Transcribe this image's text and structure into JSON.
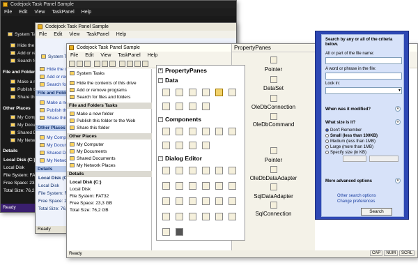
{
  "dark": {
    "title": "Codejock Task Panel Sample",
    "menu": [
      "File",
      "Edit",
      "View",
      "TaskPanel",
      "Help"
    ],
    "system_tasks": "System Tasks",
    "tasks": [
      "Hide the contents of this drive",
      "Add or remove programs",
      "Search for files and folders"
    ],
    "file_folder_title": "File and Folders Tasks",
    "file_folder_tasks": [
      "Make a new folder",
      "Publish this folder to the Web",
      "Share this folder"
    ],
    "other_title": "Other Places",
    "other": [
      "My Computer",
      "My Documents",
      "Shared Documents",
      "My Network Places"
    ],
    "details_title": "Details",
    "details": [
      "Local Disk (C:)",
      "Local Disk",
      "File System: FAT32",
      "Free Space: 23,3 GB",
      "Total Size: 76,2 GB"
    ],
    "status": "Ready"
  },
  "blue": {
    "title": "Codejock Task Panel Sample",
    "menu": [
      "File",
      "Edit",
      "View",
      "TaskPanel",
      "Help"
    ],
    "system_tasks": "System Tasks",
    "tasks": [
      "Hide the contents of this drive",
      "Add or remove programs",
      "Search for files and folders"
    ],
    "file_folder_title": "File and Folders Tasks",
    "file_folder_tasks": [
      "Make a new folder",
      "Publish this folder to the Web",
      "Share this folder"
    ],
    "other_title": "Other Places",
    "other": [
      "My Computer",
      "My Documents",
      "Shared Documents",
      "My Network Places"
    ],
    "details_title": "Details",
    "details": [
      "Local Disk (C:)",
      "Local Disk",
      "File System: FAT32",
      "Free Space: 23,3 GB",
      "Total Size: 76,2 GB"
    ],
    "status": "Ready"
  },
  "main": {
    "title": "Codejock Task Panel Sample",
    "menu": [
      "File",
      "Edit",
      "View",
      "TaskPanel",
      "Help"
    ],
    "system_tasks": "System Tasks",
    "tasks": [
      "Hide the contents of this drive",
      "Add or remove programs",
      "Search for files and folders"
    ],
    "file_folder_title": "File and Folders Tasks",
    "file_folder_tasks": [
      "Make a new folder",
      "Publish this folder to the Web",
      "Share this folder"
    ],
    "other_title": "Other Places",
    "other": [
      "My Computer",
      "My Documents",
      "Shared Documents",
      "My Network Places"
    ],
    "details_title": "Details",
    "details": [
      "Local Disk (C:)",
      "Local Disk",
      "File System: FAT32",
      "Free Space: 23,3 GB",
      "Total Size: 76,2 GB"
    ],
    "status": "Ready",
    "status_indicators": [
      "CAP",
      "NUM",
      "SCRL"
    ]
  },
  "toolbox": {
    "groups": [
      "PropertyPanes",
      "Data",
      "Components",
      "Dialog Editor"
    ]
  },
  "propertypanes": {
    "header": "PropertyPanes",
    "items": [
      "Pointer",
      "DataSet",
      "OleDbConnection",
      "OleDbCommand",
      "Pointer",
      "OleDbDataAdapter",
      "SqlDataAdapter",
      "SqlConnection"
    ]
  },
  "search": {
    "heading_line1": "Search by any or all of the criteria",
    "heading_line2": "below.",
    "label_name": "All or part of the file name:",
    "label_phrase": "A word or phrase in the file:",
    "label_lookin": "Look in:",
    "modified": "When was it modified?",
    "size": "What size is it?",
    "size_options": [
      "Don't Remember",
      "Small (less than 100KB)",
      "Medium (less than 1MB)",
      "Large (more than 1MB)",
      "Specify size (in KB)"
    ],
    "advanced": "More advanced options",
    "link_other": "Other search options",
    "link_prefs": "Change preferences",
    "search_button": "Search"
  }
}
